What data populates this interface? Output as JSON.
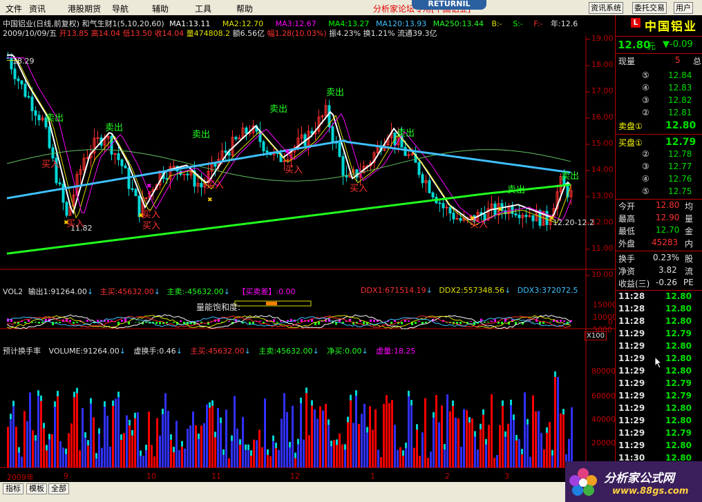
{
  "menu": {
    "items": [
      "文件",
      "资讯",
      "港股期货",
      "导航",
      "辅助",
      "工具",
      "帮助"
    ],
    "brand_text": "分析家论坛专用[中国铝业]",
    "overlay_text": "RETURNIL",
    "right_buttons": [
      "资讯系统",
      "委托交易",
      "用户"
    ]
  },
  "header": {
    "line1": {
      "indicator": "中国铝业(日线,前复权) 和气生财1(5,10,20,60)",
      "ma1": "MA1:13.11",
      "ma2": "MA2:12.70",
      "ma3": "MA3:12.67",
      "ma4": "MA4:13.27",
      "ma120": "MA120:13.93",
      "ma250": "MA250:13.44",
      "b": "B:-",
      "s": "S:-",
      "f": "F:-",
      "year": "年:12.6"
    },
    "line2": {
      "date": "2009/10/09/五",
      "open": "开13.85",
      "high": "高14.04",
      "low": "低13.50",
      "close": "收14.04",
      "vol": "量474808.2",
      "amt": "额6.56亿",
      "pct": "幅1.28(10.03%)",
      "amp": "振4.23%",
      "turn": "换1.21%",
      "float": "流通39.3亿"
    }
  },
  "main_chart": {
    "y_labels": [
      "19.00",
      "18.00",
      "17.00",
      "16.00",
      "15.00",
      "14.00",
      "13.00",
      "12.00",
      "11.00",
      "10.00"
    ],
    "annotations": {
      "high_label": "18.29",
      "low_label": "11.82",
      "range_label": "12.20-12.2",
      "buy": "买入",
      "sell": "卖出"
    }
  },
  "vol2": {
    "title": "VOL2",
    "out": "输出1:91264.00",
    "main_buy": "主买:45632.00",
    "main_sell": "主卖:-45632.00",
    "buy_sell_diff": "【买卖差】:0.00",
    "ddx1": "DDX1:671514.19",
    "ddx2": "DDX2:557348.56",
    "ddx3": "DDX3:372072.5",
    "saturation_label": "量能饱和度:",
    "y_labels": [
      "15000",
      "10000",
      "5000",
      "0"
    ],
    "scale": "X100"
  },
  "volume_panel": {
    "title": "预计换手率",
    "volume": "VOLUME:91264.00",
    "virtual_turn": "虚换手:0.46",
    "main_buy": "主买:45632.00",
    "main_sell": "主卖:45632.00",
    "net_buy": "净买:0.00",
    "virtual_vol": "虚量:18.25",
    "y_labels": [
      "80000",
      "60000",
      "40000",
      "20000"
    ],
    "x_labels": [
      "2009年",
      "9",
      "10",
      "11",
      "12",
      "1",
      "2",
      "3"
    ]
  },
  "quote": {
    "stock_name": "中国铝业",
    "price": "12.80",
    "unit": "元",
    "change": "▼-0.09",
    "current_volume_label": "现量",
    "current_volume": "5",
    "total_label": "总",
    "asks": [
      {
        "level": "⑤",
        "price": "12.84"
      },
      {
        "level": "④",
        "price": "12.83"
      },
      {
        "level": "③",
        "price": "12.82"
      },
      {
        "level": "②",
        "price": "12.81"
      }
    ],
    "ask1_label": "卖盘①",
    "ask1_price": "12.80",
    "bid1_label": "买盘①",
    "bid1_price": "12.79",
    "bids": [
      {
        "level": "②",
        "price": "12.78"
      },
      {
        "level": "③",
        "price": "12.77"
      },
      {
        "level": "④",
        "price": "12.76"
      },
      {
        "level": "⑤",
        "price": "12.75"
      }
    ],
    "stats": [
      {
        "label": "今开",
        "value": "12.80",
        "extra": "均"
      },
      {
        "label": "最高",
        "value": "12.90",
        "extra": "量"
      },
      {
        "label": "最低",
        "value": "12.70",
        "extra": "金"
      },
      {
        "label": "外盘",
        "value": "45283",
        "extra": "内"
      },
      {
        "label": "换手",
        "value": "0.23%",
        "extra": "股"
      },
      {
        "label": "净资",
        "value": "3.82",
        "extra": "流"
      },
      {
        "label": "收益(三)",
        "value": "-0.26",
        "extra": "PE"
      }
    ],
    "ticks": [
      {
        "time": "11:28",
        "price": "12.80"
      },
      {
        "time": "11:28",
        "price": "12.80"
      },
      {
        "time": "11:28",
        "price": "12.80"
      },
      {
        "time": "11:29",
        "price": "12.79"
      },
      {
        "time": "11:29",
        "price": "12.80"
      },
      {
        "time": "11:29",
        "price": "12.80"
      },
      {
        "time": "11:29",
        "price": "12.80"
      },
      {
        "time": "11:29",
        "price": "12.79"
      },
      {
        "time": "11:29",
        "price": "12.79"
      },
      {
        "time": "11:29",
        "price": "12.80"
      },
      {
        "time": "11:29",
        "price": "12.80"
      },
      {
        "time": "11:29",
        "price": "12.79"
      },
      {
        "time": "11:29",
        "price": "12.80"
      },
      {
        "time": "11:30",
        "price": "12.80"
      }
    ]
  },
  "bottom": {
    "tabs": [
      "指标",
      "模板",
      "全部"
    ],
    "watermark": "分析家公式网",
    "watermark_url": "www.88gs.com"
  },
  "colors": {
    "up": "#ff3030",
    "down": "#00d8d8",
    "green": "#00e000",
    "red_axis": "#c00000",
    "ma_white": "#ffffff",
    "ma_yellow": "#e0e000",
    "ma_cyan": "#40c0ff",
    "ma_green": "#20ff20",
    "magenta": "#ff00ff"
  }
}
